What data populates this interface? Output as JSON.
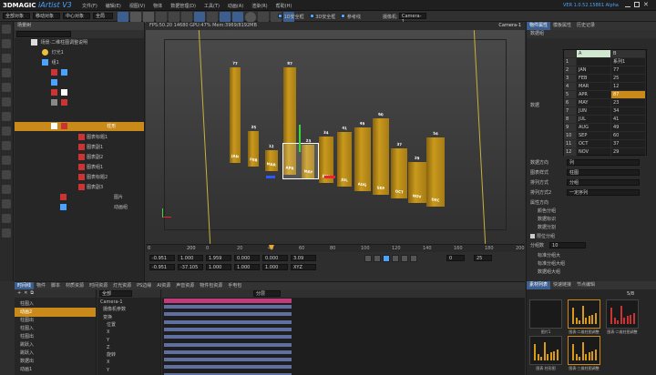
{
  "titlebar": {
    "logo": "3DMAGIC",
    "app": "iArtist V3",
    "menu": [
      "文件(F)",
      "编辑(E)",
      "视图(V)",
      "物体",
      "数据管理(D)",
      "工具(T)",
      "动画(A)",
      "渲染(R)",
      "帮助(H)"
    ],
    "right_text": "VER 1.0.52.15861 Alpha",
    "options": [
      "1D安全框",
      "3D安全框",
      "参考线"
    ],
    "camera_label": "摄像机:",
    "camera_value": "Camera-1"
  },
  "toolbar2": {
    "field1": "全部对象",
    "field2": "移动对象",
    "field3": "中心对象",
    "field4": "全局"
  },
  "tree": {
    "title": "场景树",
    "root": "场景·二维柱图调整说明",
    "items": [
      "灯光1",
      "组1",
      "图表组",
      "柱形图",
      "图表标题1",
      "图表副1",
      "图表副2",
      "图表组1",
      "图表标题2",
      "图表副3",
      "图片",
      "动画组"
    ],
    "selected_label": "柱形"
  },
  "viewport": {
    "stats": "FPS:50.20   14680    GPU:47% Mem:3969/8192MB",
    "camera": "Camera-1"
  },
  "chart_data": {
    "type": "bar",
    "categories": [
      "JAN",
      "FEB",
      "MAR",
      "APR",
      "MAY",
      "JUN",
      "JUL",
      "AUG",
      "SEP",
      "OCT",
      "NOV",
      "DEC"
    ],
    "values": [
      77,
      25,
      12,
      87,
      23,
      34,
      41,
      49,
      60,
      37,
      29,
      54
    ],
    "title": "",
    "xlabel": "",
    "ylabel": ""
  },
  "timeline": {
    "start": "0",
    "end": "200",
    "ticks": [
      "0",
      "20",
      "40",
      "60",
      "80",
      "100",
      "120",
      "140",
      "160",
      "180",
      "200"
    ],
    "coords1": [
      "-0.951",
      "1.000",
      "1.959",
      "0.000",
      "0.000",
      "3.09"
    ],
    "coords2": [
      "-0.951",
      "-37.105",
      "1.000",
      "1.000",
      "1.000",
      "XYZ"
    ],
    "frame": "0",
    "fps": "25"
  },
  "bottom_tabs": [
    "时间线",
    "物件",
    "脚本",
    "材质资源",
    "时间资源",
    "灯光资源",
    "PS边缘",
    "AI资源",
    "声音资源",
    "物件包资源",
    "手电包"
  ],
  "bottom_left": {
    "items": [
      "柱图入",
      "柱图2",
      "柱图出",
      "柱图入",
      "柱图出",
      "跳跃入",
      "跳跃入",
      "数据出",
      "动画1"
    ],
    "selected": "动画2",
    "filter": "全部",
    "mode": "分层"
  },
  "keyframe_tree": [
    "Camera-1",
    "摄像机参数",
    "变换",
    "位置",
    "X",
    "Y",
    "Z",
    "旋转",
    "X",
    "Y"
  ],
  "right_panel": {
    "tabs": [
      "物件属性",
      "模板属性",
      "历史记录"
    ],
    "section": "数据组",
    "data_label": "数据",
    "table_header": [
      "",
      "A",
      "B"
    ],
    "table_rows": [
      [
        "1",
        "",
        ""
      ],
      [
        "2",
        "JAN",
        "77"
      ],
      [
        "3",
        "FEB",
        "25"
      ],
      [
        "4",
        "MAR",
        "12"
      ],
      [
        "5",
        "APR",
        "87"
      ],
      [
        "6",
        "MAY",
        "23"
      ],
      [
        "7",
        "JUN",
        "34"
      ],
      [
        "8",
        "JUL",
        "41"
      ],
      [
        "9",
        "AUG",
        "49"
      ],
      [
        "10",
        "SEP",
        "60"
      ],
      [
        "11",
        "OCT",
        "37"
      ],
      [
        "12",
        "NOV",
        "29"
      ]
    ],
    "table_extra": "系列1",
    "props": [
      [
        "数据方向",
        "列"
      ],
      [
        "图表样式",
        "柱图"
      ],
      [
        "排列方式",
        "分组"
      ],
      [
        "排列方式2",
        "一定序列"
      ]
    ],
    "props2": [
      "属性方向",
      "颜色分组",
      "数据标识",
      "数据分割"
    ],
    "checkbox": "限位分组",
    "field_label": "分组数",
    "field_value": "10",
    "bottom_labels": [
      "标准分组大",
      "标准分组大组",
      "数据组大组"
    ]
  },
  "assets": {
    "tabs": [
      "素材列表",
      "快速链接",
      "节点编辑"
    ],
    "count": "5/8",
    "items": [
      "图片1",
      "图表·二维柱图调整",
      "图表·二维柱图调整",
      "图表 柱形图",
      "图表·三维柱图调整"
    ]
  }
}
